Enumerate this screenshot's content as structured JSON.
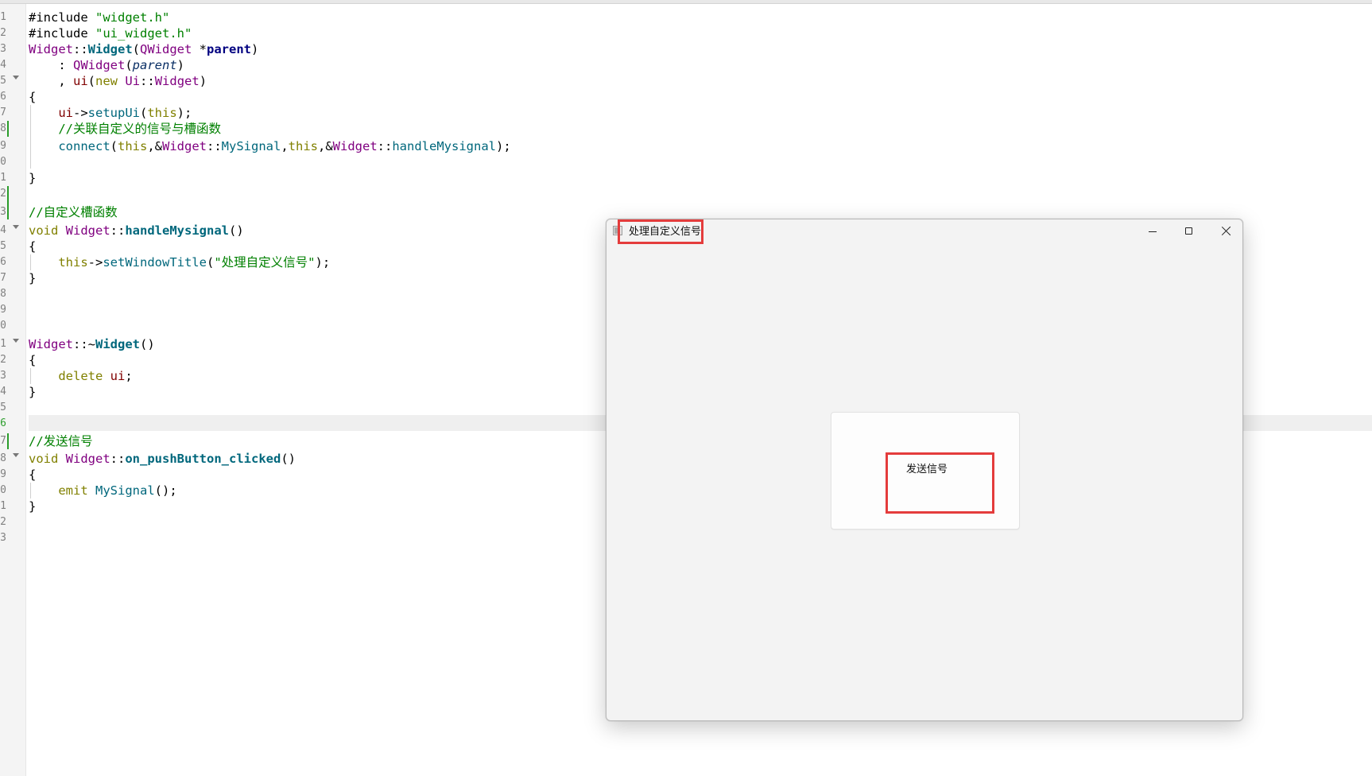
{
  "editor": {
    "line_numbers": [
      "1",
      "2",
      "3",
      "4",
      "5",
      "6",
      "7",
      "8",
      "9",
      "0",
      "1",
      "2",
      "3",
      "4",
      "5",
      "6",
      "7",
      "8",
      "9",
      "0",
      "1",
      "2",
      "3",
      "4",
      "5",
      "6",
      "7",
      "8",
      "9",
      "0",
      "1",
      "2",
      "3"
    ],
    "code": {
      "l1": [
        "#include ",
        "\"widget.h\""
      ],
      "l2": [
        "#include ",
        "\"ui_widget.h\""
      ],
      "l3": [
        "Widget",
        "::",
        "Widget",
        "(",
        "QWidget",
        " *",
        "parent",
        ")"
      ],
      "l4": [
        "    : ",
        "QWidget",
        "(",
        "parent",
        ")"
      ],
      "l5": [
        "    , ",
        "ui",
        "(",
        "new",
        " ",
        "Ui",
        "::",
        "Widget",
        ")"
      ],
      "l6": [
        "{"
      ],
      "l7": [
        "    ",
        "ui",
        "->",
        "setupUi",
        "(",
        "this",
        ");"
      ],
      "l8": [
        "    //关联自定义的信号与槽函数"
      ],
      "l9": [
        "    ",
        "connect",
        "(",
        "this",
        ",&",
        "Widget",
        "::",
        "MySignal",
        ",",
        "this",
        ",&",
        "Widget",
        "::",
        "handleMysignal",
        ");"
      ],
      "l11": [
        "}"
      ],
      "l13": [
        "//自定义槽函数"
      ],
      "l14": [
        "void",
        " ",
        "Widget",
        "::",
        "handleMysignal",
        "()"
      ],
      "l15": [
        "{"
      ],
      "l16": [
        "    ",
        "this",
        "->",
        "setWindowTitle",
        "(",
        "\"处理自定义信号\"",
        ");"
      ],
      "l17": [
        "}"
      ],
      "l21": [
        "Widget",
        "::~",
        "Widget",
        "()"
      ],
      "l22": [
        "{"
      ],
      "l23": [
        "    ",
        "delete",
        " ",
        "ui",
        ";"
      ],
      "l24": [
        "}"
      ],
      "l27": [
        "//发送信号"
      ],
      "l28": [
        "void",
        " ",
        "Widget",
        "::",
        "on_pushButton_clicked",
        "()"
      ],
      "l29": [
        "{"
      ],
      "l30": [
        "    ",
        "emit",
        " ",
        "MySignal",
        "();"
      ],
      "l31": [
        "}"
      ]
    }
  },
  "window": {
    "title": "处理自定义信号",
    "minimize_symbol": "–",
    "button_label": "发送信号"
  },
  "colors": {
    "highlight": "#e43c3c",
    "keyword": "#808000",
    "type": "#800080",
    "function": "#00677c",
    "string_comment": "#008000"
  }
}
